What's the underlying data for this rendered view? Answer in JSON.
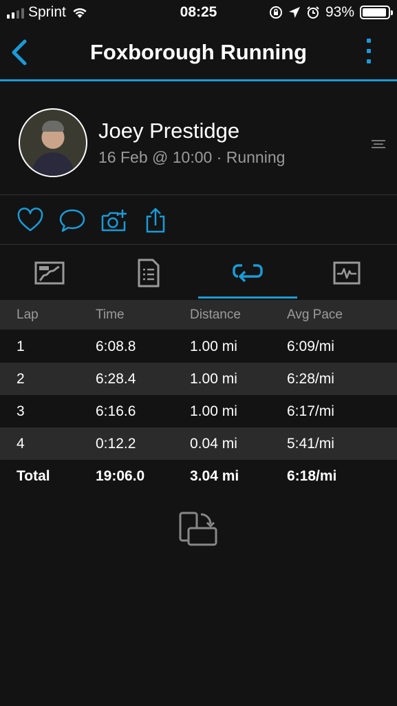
{
  "status_bar": {
    "carrier": "Sprint",
    "time": "08:25",
    "battery_percent": "93%",
    "battery_level": 0.93,
    "signal_bars": 2,
    "icons": [
      "signal-icon",
      "wifi-icon",
      "orientation-lock-icon",
      "location-arrow-icon",
      "alarm-icon",
      "battery-icon"
    ]
  },
  "nav": {
    "title": "Foxborough Running",
    "back_icon": "chevron-left-icon",
    "more_icon": "more-vertical-icon"
  },
  "profile": {
    "name": "Joey Prestidge",
    "meta": "16 Feb @ 10:00 · Running"
  },
  "actions": {
    "icons": [
      "heart-icon",
      "comment-icon",
      "add-photo-icon",
      "share-icon"
    ]
  },
  "tabs": {
    "icons": [
      "map-icon",
      "details-icon",
      "laps-icon",
      "charts-icon"
    ],
    "active_index": 2
  },
  "laps": {
    "headers": [
      "Lap",
      "Time",
      "Distance",
      "Avg Pace"
    ],
    "rows": [
      [
        "1",
        "6:08.8",
        "1.00 mi",
        "6:09/mi"
      ],
      [
        "2",
        "6:28.4",
        "1.00 mi",
        "6:28/mi"
      ],
      [
        "3",
        "6:16.6",
        "1.00 mi",
        "6:17/mi"
      ],
      [
        "4",
        "0:12.2",
        "0.04 mi",
        "5:41/mi"
      ]
    ],
    "total": [
      "Total",
      "19:06.0",
      "3.04 mi",
      "6:18/mi"
    ]
  },
  "colors": {
    "accent": "#1a9bd7",
    "background": "#131313",
    "row_alt": "#2b2b2b",
    "muted_text": "#9a9a9a"
  }
}
